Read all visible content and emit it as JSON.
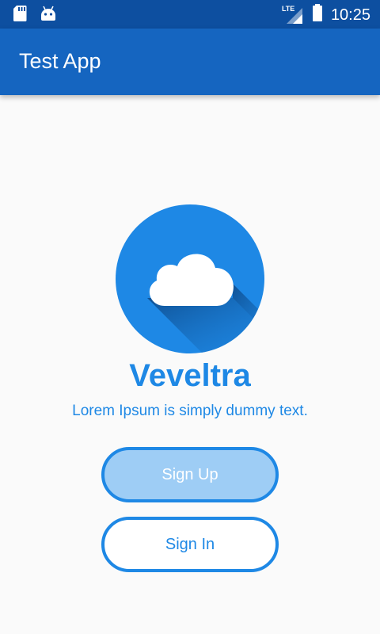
{
  "status_bar": {
    "time": "10:25",
    "network_label": "LTE",
    "icons": [
      "sd-card-icon",
      "android-icon",
      "signal-icon",
      "battery-icon"
    ]
  },
  "app_bar": {
    "title": "Test App"
  },
  "main": {
    "logo_icon": "cloud-icon",
    "brand_name": "Veveltra",
    "tagline": "Lorem Ipsum is simply dummy text.",
    "signup_label": "Sign Up",
    "signin_label": "Sign In"
  },
  "colors": {
    "status_bar": "#0d4fa0",
    "app_bar": "#1565c0",
    "accent": "#1e88e5",
    "signup_fill": "#9ecdf5",
    "background": "#fafafa"
  }
}
